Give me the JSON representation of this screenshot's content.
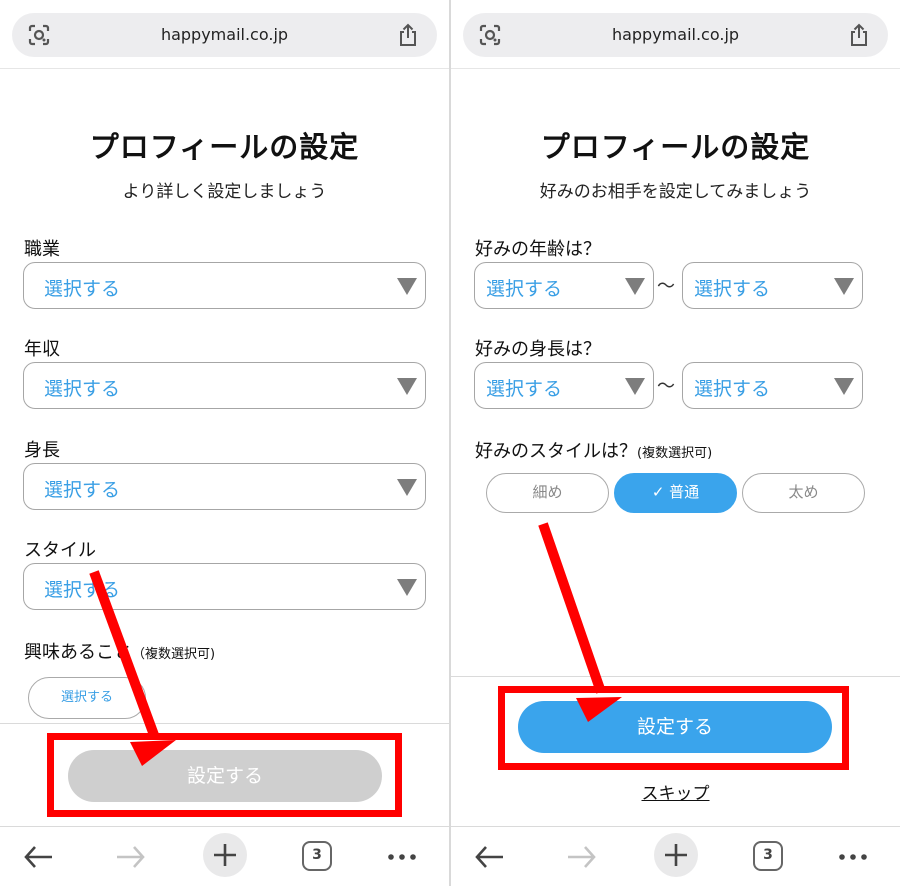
{
  "browser": {
    "url": "happymail.co.jp",
    "tab_count": "3"
  },
  "left": {
    "title": "プロフィールの設定",
    "subtitle": "より詳しく設定しましょう",
    "fields": [
      {
        "label": "職業",
        "value": "選択する"
      },
      {
        "label": "年収",
        "value": "選択する"
      },
      {
        "label": "身長",
        "value": "選択する"
      },
      {
        "label": "スタイル",
        "value": "選択する"
      }
    ],
    "interests_label": "興味あること",
    "interests_note": "（複数選択可)",
    "interests_button": "選択する",
    "submit_label": "設定する"
  },
  "right": {
    "title": "プロフィールの設定",
    "subtitle": "好みのお相手を設定してみましょう",
    "age_label": "好みの年齢は？",
    "age_from": "選択する",
    "age_to": "選択する",
    "height_label": "好みの身長は？",
    "height_from": "選択する",
    "height_to": "選択する",
    "range_sep": "〜",
    "style_label": "好みのスタイルは？",
    "style_note": "(複数選択可)",
    "style_options": [
      {
        "label": "細め",
        "selected": false
      },
      {
        "label": "普通",
        "selected": true
      },
      {
        "label": "太め",
        "selected": false
      }
    ],
    "check_mark": "✓",
    "submit_label": "設定する",
    "skip_label": "スキップ"
  },
  "colors": {
    "accent": "#3aa4ec",
    "highlight": "#ff0000",
    "disabled": "#cfcfcf"
  },
  "icons": [
    "lens-icon",
    "share-icon",
    "back-arrow-icon",
    "forward-arrow-icon",
    "plus-icon",
    "tabs-icon",
    "more-icon"
  ]
}
